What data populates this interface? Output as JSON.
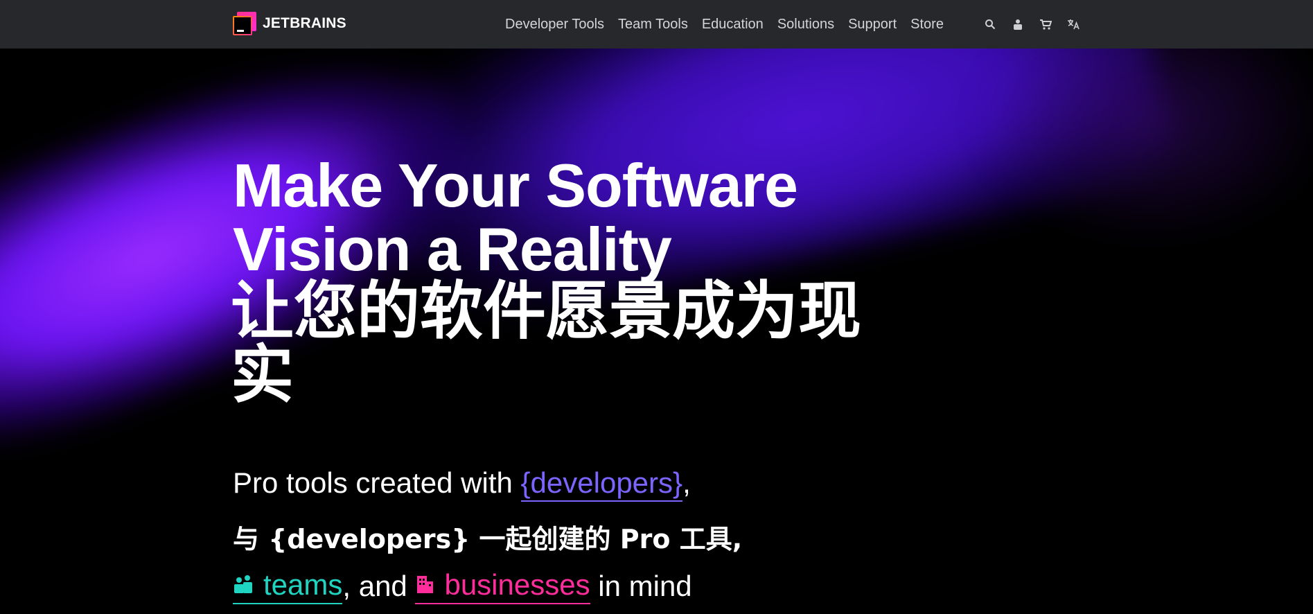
{
  "brand": {
    "name": "JETBRAINS"
  },
  "nav": {
    "items": [
      {
        "label": "Developer Tools"
      },
      {
        "label": "Team Tools"
      },
      {
        "label": "Education"
      },
      {
        "label": "Solutions"
      },
      {
        "label": "Support"
      },
      {
        "label": "Store"
      }
    ],
    "icons": [
      "search-icon",
      "user-icon",
      "cart-icon",
      "translate-icon"
    ]
  },
  "hero": {
    "headline": "Make Your Software Vision a Reality",
    "headline_translation": "让您的软件愿景成为现实",
    "tagline_prefix": "Pro tools created with ",
    "developers_link": "{developers}",
    "tagline_comma": ",",
    "tagline_translation": "与 {developers} 一起创建的 Pro 工具,",
    "teams_link": "teams",
    "and_text": ", and ",
    "businesses_link": "businesses",
    "in_mind": " in mind"
  },
  "colors": {
    "topbar": "#27282c",
    "developers": "#7b65ff",
    "teams": "#1fd4c1",
    "businesses": "#ff2d9b"
  }
}
